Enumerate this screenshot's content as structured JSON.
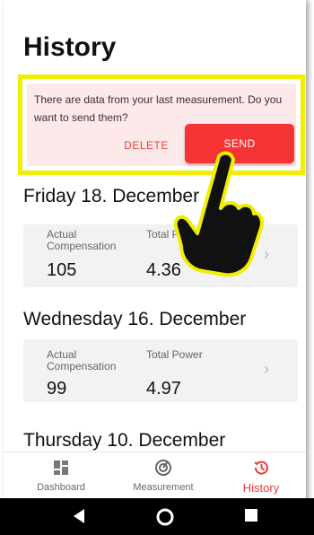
{
  "header": {
    "title": "History"
  },
  "banner": {
    "message": "There are data from your last measurement. Do you want to send them?",
    "delete_label": "DELETE",
    "send_label": "SEND"
  },
  "entries": [
    {
      "date": "Friday 18. December",
      "comp_label": "Actual Compensation",
      "power_label": "Total Power",
      "comp_value": "105",
      "power_value": "4.36"
    },
    {
      "date": "Wednesday 16. December",
      "comp_label": "Actual Compensation",
      "power_label": "Total Power",
      "comp_value": "99",
      "power_value": "4.97"
    },
    {
      "date": "Thursday 10. December"
    }
  ],
  "nav": {
    "items": [
      {
        "label": "Dashboard",
        "icon": "dashboard-icon"
      },
      {
        "label": "Measurement",
        "icon": "measurement-icon"
      },
      {
        "label": "History",
        "icon": "history-icon",
        "active": true
      }
    ]
  },
  "system_nav": {
    "back": "back-icon",
    "home": "home-icon",
    "recents": "recents-icon"
  },
  "colors": {
    "accent": "#f43434",
    "highlight": "#f2ee00",
    "banner_bg": "#fde9e9",
    "card_bg": "#f2f2f4"
  }
}
